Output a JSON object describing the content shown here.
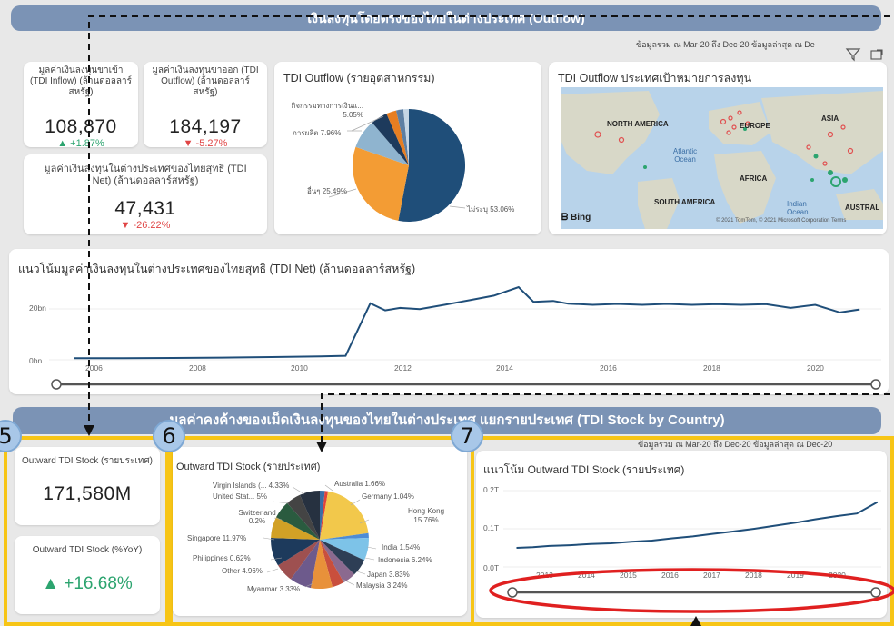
{
  "top_banner": {
    "title": "เงินลงทุนโดยตรงของไทยในต่างประเทศ (Outflow)"
  },
  "date_info": {
    "text": "ข้อมูลรวม ณ Mar-20 ถึง Dec-20   ข้อมูลล่าสุด ณ De"
  },
  "kpi": {
    "inflow": {
      "label": "มูลค่าเงินลงทุนขาเข้า (TDI Inflow) (ล้านดอลลาร์สหรัฐ)",
      "value": "108,870",
      "delta": "▲ +1.87%"
    },
    "outflow": {
      "label": "มูลค่าเงินลงทุนขาออก (TDI Outflow) (ล้านดอลลาร์สหรัฐ)",
      "value": "184,197",
      "delta": "▼ -5.27%"
    },
    "net": {
      "label": "มูลค่าเงินลงทุนในต่างประเทศของไทยสุทธิ (TDI Net) (ล้านดอลลาร์สหรัฐ)",
      "value": "47,431",
      "delta": "▼ -26.22%"
    }
  },
  "industry_pie": {
    "title": "TDI Outflow (รายอุตสาหกรรม)",
    "labels": [
      "กิจกรรมทางการเงินแ... 5.05%",
      "การผลิต 7.96%",
      "อื่นๆ 25.49%",
      "ไม่ระบุ 53.06%"
    ]
  },
  "map": {
    "title": "TDI Outflow ประเทศเป้าหมายการลงทุน",
    "labels": [
      "NORTH AMERICA",
      "EUROPE",
      "ASIA",
      "Atlantic Ocean",
      "AFRICA",
      "SOUTH AMERICA",
      "Indian Ocean",
      "AUSTRAL"
    ],
    "bing": "Bing",
    "copyright": "© 2021 TomTom, © 2021 Microsoft Corporation Terms"
  },
  "net_trend": {
    "title": "แนวโน้มมูลค่าเงินลงทุนในต่างประเทศของไทยสุทธิ (TDI Net) (ล้านดอลลาร์สหรัฐ)",
    "y_ticks": [
      "20bn",
      "0bn"
    ],
    "x_ticks": [
      "2006",
      "2008",
      "2010",
      "2012",
      "2014",
      "2016",
      "2018",
      "2020"
    ]
  },
  "stock_banner": {
    "title": "มูลค่าคงค้างของเม็ดเงินลงทุนของไทยในต่างประเทศ แยกรายประเทศ (TDI Stock by Country)"
  },
  "stock_date_info": {
    "text": "ข้อมูลรวม ณ Mar-20 ถึง Dec-20   ข้อมูลล่าสุด ณ Dec-20"
  },
  "stock_kpi": {
    "stock": {
      "label": "Outward TDI Stock (รายประเทศ)",
      "value": "171,580M"
    },
    "yoy": {
      "label": "Outward TDI Stock (%YoY)",
      "value": "▲ +16.68%"
    }
  },
  "country_pie": {
    "title": "Outward TDI Stock (รายประเทศ)",
    "labels": [
      "Virgin Islands (... 4.33%",
      "United Stat... 5%",
      "Switzerland 0.2%",
      "Singapore 11.97%",
      "Philippines 0.62%",
      "Other 4.96%",
      "Myanmar 3.33%",
      "Australia 1.66%",
      "Germany 1.04%",
      "Hong Kong 15.76%",
      "India 1.54%",
      "Indonesia 6.24%",
      "Japan 3.83%",
      "Malaysia 3.24%"
    ]
  },
  "stock_trend": {
    "title": "แนวโน้ม Outward TDI Stock (รายประเทศ)",
    "y_ticks": [
      "0.2T",
      "0.1T",
      "0.0T"
    ],
    "x_ticks": [
      "2013",
      "2014",
      "2015",
      "2016",
      "2017",
      "2018",
      "2019",
      "2020"
    ]
  },
  "annotations": {
    "n5": "5",
    "n6": "6",
    "n7": "7"
  },
  "colors": {
    "banner": "#7b93b5",
    "line": "#1f4e79",
    "highlight": "#f7c516",
    "oval": "#e02020",
    "up": "#2ca46f",
    "down": "#e04545"
  },
  "chart_data": [
    {
      "type": "line",
      "title": "แนวโน้มมูลค่าเงินลงทุนในต่างประเทศของไทยสุทธิ (TDI Net) (ล้านดอลลาร์สหรัฐ)",
      "ylim": [
        0,
        25
      ],
      "x": [
        2005,
        2006,
        2007,
        2008,
        2009,
        2010,
        2010.5,
        2011,
        2011.3,
        2011.6,
        2012,
        2012.5,
        2013,
        2013.5,
        2014,
        2014.3,
        2014.7,
        2015,
        2015.5,
        2016,
        2016.5,
        2017,
        2017.5,
        2018,
        2018.5,
        2019,
        2019.5,
        2020,
        2020.5,
        2020.9
      ],
      "values": [
        0.5,
        0.5,
        0.6,
        0.7,
        0.9,
        1.1,
        1.3,
        18.5,
        16.2,
        17.0,
        16.6,
        18.0,
        19.5,
        21.0,
        23.8,
        19.0,
        19.3,
        18.4,
        18.0,
        18.3,
        18.0,
        18.3,
        18.0,
        18.2,
        18.0,
        18.2,
        17.0,
        18.0,
        15.5,
        16.5
      ]
    },
    {
      "type": "line",
      "title": "แนวโน้ม Outward TDI Stock (รายประเทศ)",
      "ylim": [
        0,
        0.2
      ],
      "x": [
        2012.2,
        2012.6,
        2013,
        2013.5,
        2014,
        2014.5,
        2015,
        2015.5,
        2016,
        2016.5,
        2017,
        2017.5,
        2018,
        2018.5,
        2019,
        2019.5,
        2020,
        2020.5,
        2021
      ],
      "values": [
        0.05,
        0.052,
        0.055,
        0.057,
        0.06,
        0.062,
        0.066,
        0.069,
        0.075,
        0.08,
        0.087,
        0.093,
        0.1,
        0.108,
        0.116,
        0.125,
        0.133,
        0.14,
        0.17
      ]
    },
    {
      "type": "pie",
      "title": "TDI Outflow (รายอุตสาหกรรม)",
      "categories": [
        "ไม่ระบุ",
        "อื่นๆ",
        "การผลิต",
        "กิจกรรมทางการเงิน",
        "other"
      ],
      "values": [
        53.06,
        25.49,
        7.96,
        5.05,
        8.44
      ]
    },
    {
      "type": "pie",
      "title": "Outward TDI Stock (รายประเทศ)",
      "categories": [
        "Australia",
        "Germany",
        "Hong Kong",
        "India",
        "Indonesia",
        "Japan",
        "Malaysia",
        "Myanmar",
        "Other",
        "Philippines",
        "Singapore",
        "Switzerland",
        "United States",
        "Virgin Islands",
        "rest"
      ],
      "values": [
        1.66,
        1.04,
        15.76,
        1.54,
        6.24,
        3.83,
        3.24,
        3.33,
        4.96,
        0.62,
        11.97,
        0.2,
        5,
        4.33,
        36.28
      ]
    }
  ]
}
